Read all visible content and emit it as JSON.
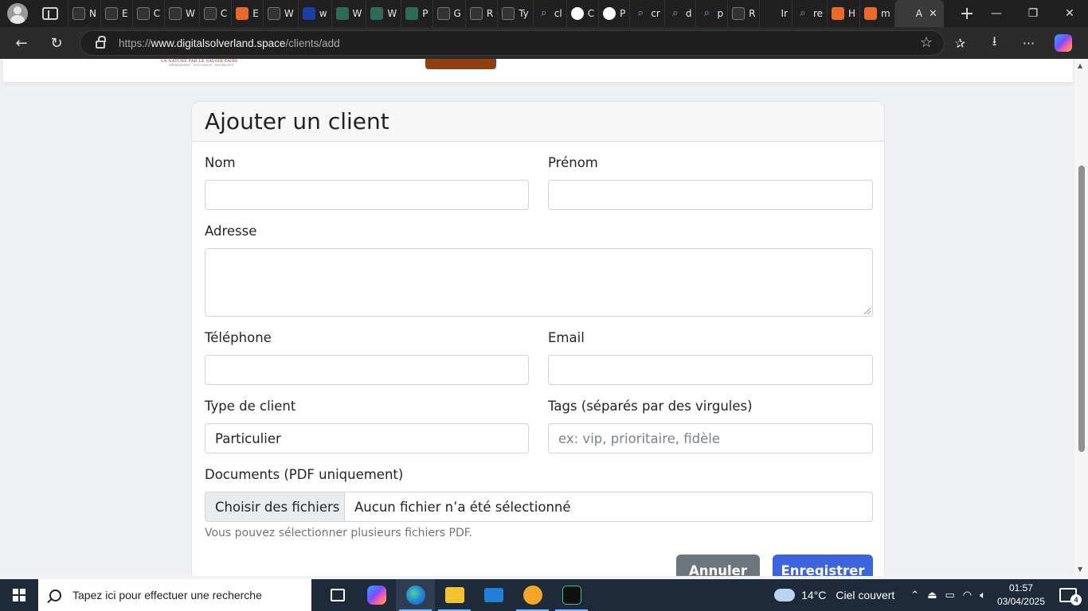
{
  "browser": {
    "tabs": [
      {
        "label": "N",
        "icon": "globe-icon"
      },
      {
        "label": "E",
        "icon": "backslash-icon"
      },
      {
        "label": "C",
        "icon": "backslash-icon"
      },
      {
        "label": "W",
        "icon": "backslash-icon"
      },
      {
        "label": "C",
        "icon": "backslash-icon"
      },
      {
        "label": "E",
        "icon": "orange-dots-icon"
      },
      {
        "label": "W",
        "icon": "backslash-icon"
      },
      {
        "label": "w",
        "icon": "bing-icon"
      },
      {
        "label": "W",
        "icon": "green-square-icon"
      },
      {
        "label": "W",
        "icon": "green-square-icon"
      },
      {
        "label": "P",
        "icon": "green-square-icon"
      },
      {
        "label": "G",
        "icon": "github-icon"
      },
      {
        "label": "R",
        "icon": "github-icon"
      },
      {
        "label": "Ty",
        "icon": "terminal-icon"
      },
      {
        "label": "cl",
        "icon": "search-icon"
      },
      {
        "label": "C",
        "icon": "openai-icon"
      },
      {
        "label": "P",
        "icon": "openai-icon"
      },
      {
        "label": "cr",
        "icon": "search-icon"
      },
      {
        "label": "d",
        "icon": "search-icon"
      },
      {
        "label": "p",
        "icon": "search-icon"
      },
      {
        "label": "R",
        "icon": "image-icon"
      },
      {
        "label": "Ir",
        "icon": "blank-icon"
      },
      {
        "label": "re",
        "icon": "search-icon"
      },
      {
        "label": "H",
        "icon": "orange-dots-icon"
      },
      {
        "label": "m",
        "icon": "orange-dots-icon"
      },
      {
        "label": "A",
        "icon": "blank-icon",
        "active": true
      }
    ],
    "url_prefix": "https://",
    "url_host": "www.digitalsolverland.space",
    "url_path": "/clients/add"
  },
  "site": {
    "logo_tagline": "LA NATURE PAR LE SAVOIR-FAIRE",
    "logo_subline": "AMÉNAGEMENT · ÉCOLOGIQUE · NATURALISTE"
  },
  "form": {
    "title": "Ajouter un client",
    "nom_label": "Nom",
    "nom_value": "",
    "prenom_label": "Prénom",
    "prenom_value": "",
    "adresse_label": "Adresse",
    "adresse_value": "",
    "telephone_label": "Téléphone",
    "telephone_value": "",
    "email_label": "Email",
    "email_value": "",
    "type_label": "Type de client",
    "type_value": "Particulier",
    "tags_label": "Tags (séparés par des virgules)",
    "tags_placeholder": "ex: vip, prioritaire, fidèle",
    "documents_label": "Documents (PDF uniquement)",
    "file_button": "Choisir des fichiers",
    "file_status": "Aucun fichier n’a été sélectionné",
    "help": "Vous pouvez sélectionner plusieurs fichiers PDF.",
    "cancel": "Annuler",
    "save": "Enregistrer"
  },
  "taskbar": {
    "search_placeholder": "Tapez ici pour effectuer une recherche",
    "weather_temp": "14°C",
    "weather_text": "Ciel couvert",
    "time": "01:57",
    "date": "03/04/2025",
    "notification_count": "4"
  },
  "colors": {
    "primary": "#3d63dd",
    "secondary": "#6c757d",
    "header_button": "#8f3f12"
  }
}
